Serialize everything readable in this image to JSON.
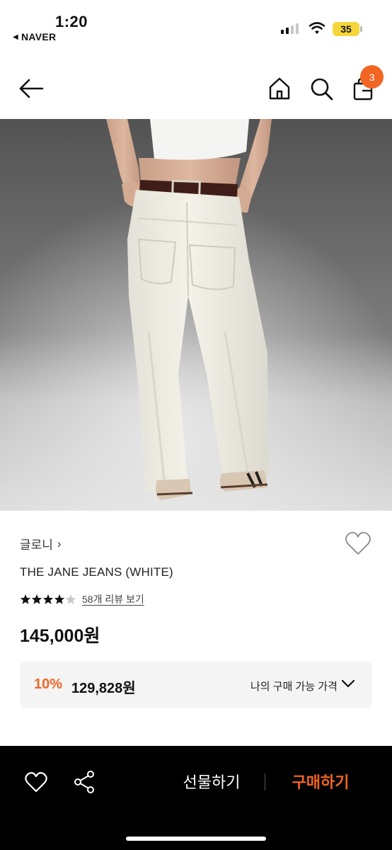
{
  "status_bar": {
    "time": "1:20",
    "back_app": "NAVER",
    "battery": "35",
    "colors": {
      "battery_fill": "#f6d63a"
    }
  },
  "nav": {
    "back_icon": "arrow-left-icon",
    "home_icon": "home-icon",
    "search_icon": "search-icon",
    "cart_icon": "shopping-bag-icon",
    "cart_count": "3",
    "colors": {
      "badge": "#f26522"
    }
  },
  "product": {
    "image_alt": "THE JANE JEANS (WHITE)",
    "brand": "글로니",
    "brand_chevron": "›",
    "name": "THE JANE JEANS (WHITE)",
    "rating": 4.5,
    "review_link": "58개 리뷰 보기",
    "price": "145,000원"
  },
  "discount": {
    "rate": "10%",
    "price": "129,828원",
    "label": "나의 구매 가능 가격",
    "colors": {
      "accent": "#f26522",
      "background": "#f4f4f4"
    }
  },
  "bottom_bar": {
    "heart_icon": "heart-outline-icon",
    "share_icon": "share-icon",
    "gift_label": "선물하기",
    "buy_label": "구매하기",
    "colors": {
      "background": "#000000",
      "buy": "#f26522"
    }
  }
}
